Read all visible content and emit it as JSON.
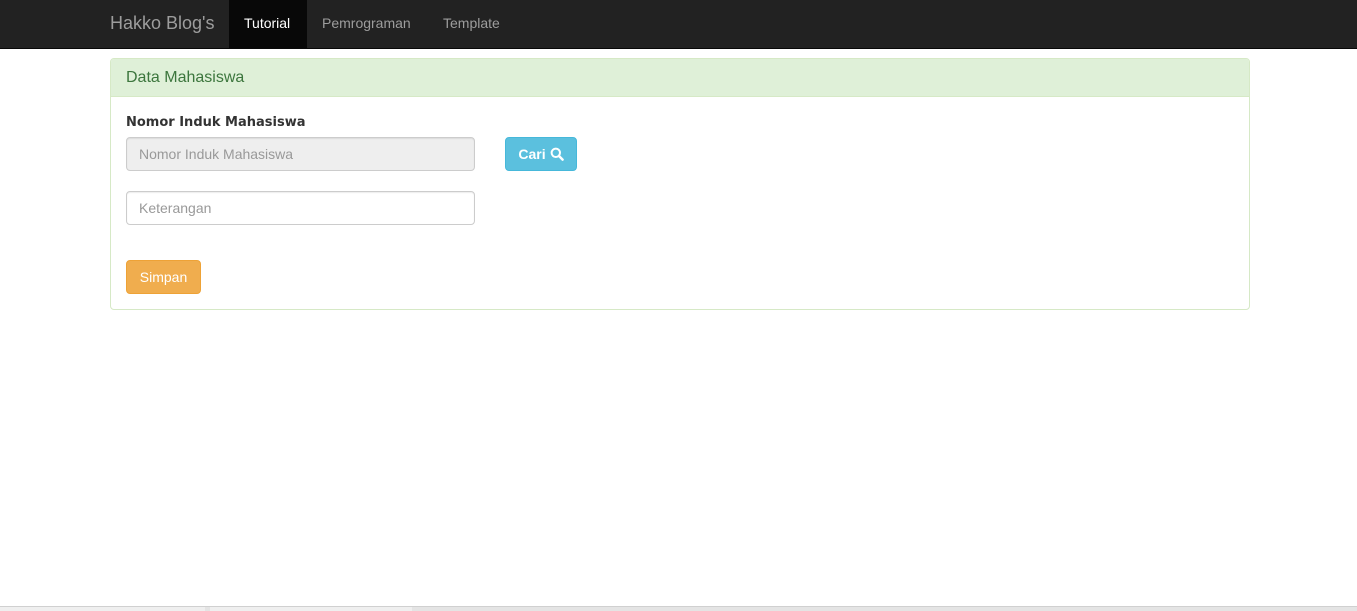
{
  "navbar": {
    "brand": "Hakko Blog's",
    "items": [
      {
        "label": "Tutorial",
        "active": true
      },
      {
        "label": "Pemrograman",
        "active": false
      },
      {
        "label": "Template",
        "active": false
      }
    ]
  },
  "panel": {
    "title": "Data Mahasiswa",
    "nim": {
      "label": "Nomor Induk Mahasiswa",
      "placeholder": "Nomor Induk Mahasiswa",
      "value": ""
    },
    "keterangan": {
      "placeholder": "Keterangan",
      "value": ""
    },
    "search_button": {
      "label": "Cari",
      "icon": "search-icon"
    },
    "save_button": {
      "label": "Simpan"
    }
  },
  "colors": {
    "navbar_bg": "#222222",
    "panel_heading_bg": "#dff0d8",
    "panel_heading_text": "#3c763d",
    "info_button": "#5bc0de",
    "warning_button": "#f0ad4e"
  }
}
